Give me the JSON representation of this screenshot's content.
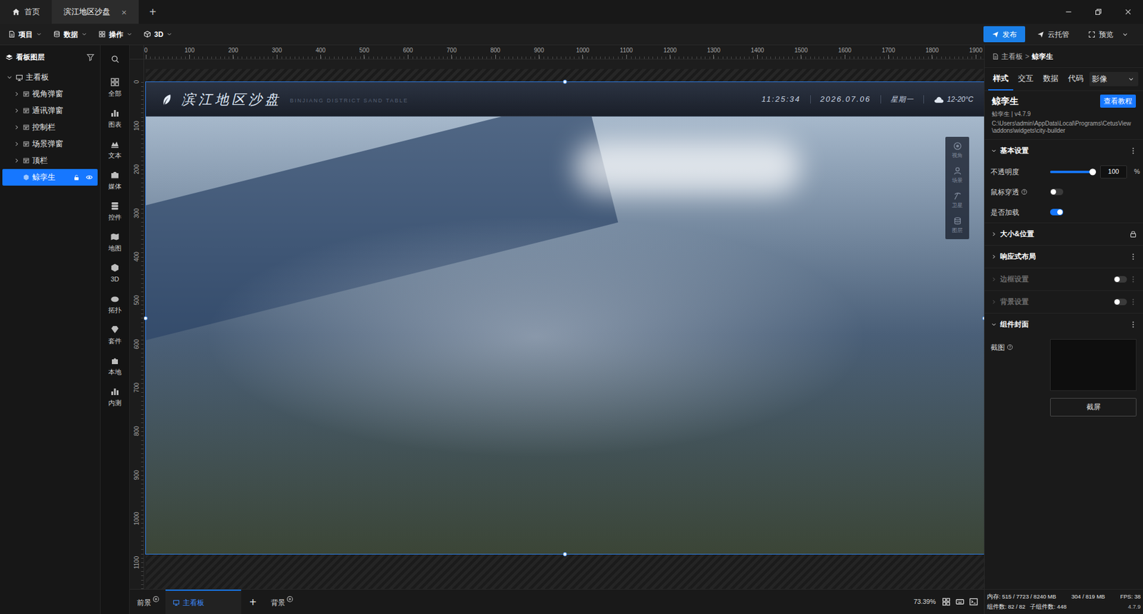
{
  "window": {
    "tabs": [
      {
        "label": "首页",
        "selected": false,
        "closable": false
      },
      {
        "label": "滨江地区沙盘",
        "selected": true,
        "closable": true
      }
    ],
    "close_glyph": "×",
    "new_tab": "+"
  },
  "menu": [
    "项目",
    "数据",
    "操作",
    "3D"
  ],
  "actions": [
    {
      "label": "发布",
      "kind": "primary"
    },
    {
      "label": "云托管",
      "kind": "plain"
    },
    {
      "label": "预览",
      "kind": "dropdown"
    }
  ],
  "layers": {
    "title": "看板图层",
    "items": [
      {
        "label": "主看板",
        "depth": 0,
        "kind": "board",
        "expanded": true,
        "selected": false
      },
      {
        "label": "视角弹窗",
        "depth": 1,
        "kind": "group",
        "expanded": false,
        "selected": false
      },
      {
        "label": "通讯弹窗",
        "depth": 1,
        "kind": "group",
        "expanded": false,
        "selected": false
      },
      {
        "label": "控制栏",
        "depth": 1,
        "kind": "group",
        "expanded": false,
        "selected": false
      },
      {
        "label": "场景弹窗",
        "depth": 1,
        "kind": "group",
        "expanded": false,
        "selected": false
      },
      {
        "label": "顶栏",
        "depth": 1,
        "kind": "group",
        "expanded": false,
        "selected": false
      },
      {
        "label": "鲸孪生",
        "depth": 1,
        "kind": "widget",
        "expanded": false,
        "selected": true,
        "locked": false,
        "visible": true
      }
    ]
  },
  "toolbox": [
    "全部",
    "图表",
    "文本",
    "媒体",
    "控件",
    "地图",
    "3D",
    "拓扑",
    "套件",
    "本地",
    "内测"
  ],
  "ruler": {
    "horizontal": [
      "0",
      "100",
      "200",
      "300",
      "400",
      "500",
      "600",
      "700",
      "800",
      "900",
      "1000",
      "1100",
      "1200",
      "1300",
      "1400",
      "1500",
      "1600",
      "1700",
      "1800",
      "1900"
    ],
    "vertical": [
      "0",
      "100",
      "200",
      "300",
      "400",
      "500",
      "600",
      "700",
      "800",
      "900",
      "1000",
      "1100"
    ]
  },
  "dashboard": {
    "title": "滨江地区沙盘",
    "subtitle": "BINJIANG DISTRICT SAND TABLE",
    "time": "11:25:34",
    "date": "2026.07.06",
    "weekday": "星期一",
    "weather": "12-20°C",
    "tools": [
      "视角",
      "场景",
      "卫星",
      "图层"
    ]
  },
  "bottom": {
    "items": [
      {
        "label": "前景",
        "kind": "layer",
        "selected": false
      },
      {
        "label": "主看板",
        "kind": "board",
        "selected": true
      },
      {
        "label": "+",
        "kind": "add",
        "selected": false
      },
      {
        "label": "背景",
        "kind": "layer",
        "selected": false
      }
    ],
    "zoom": "73.39%"
  },
  "inspector": {
    "breadcrumb": [
      "主看板",
      "鲸孪生"
    ],
    "separator": ">",
    "tabs": [
      {
        "label": "样式",
        "selected": true,
        "dropdown": false
      },
      {
        "label": "交互",
        "selected": false,
        "dropdown": false
      },
      {
        "label": "数据",
        "selected": false,
        "dropdown": false
      },
      {
        "label": "代码",
        "selected": false,
        "dropdown": false
      },
      {
        "label": "影像",
        "selected": false,
        "dropdown": true
      }
    ],
    "name": "鲸孪生",
    "tutorial": "查看教程",
    "version": "鲸孪生 | v4.7.9",
    "path": "C:\\Users\\admin\\AppData\\Local\\Programs\\CetusView\\addons\\widgets\\city-builder",
    "sections": [
      {
        "title": "基本设置",
        "kind": "menu",
        "expanded": true,
        "disabled": false,
        "fields": [
          {
            "label": "不透明度",
            "kind": "slider",
            "help": false,
            "level": 1,
            "value": "100",
            "unit": "%"
          },
          {
            "label": "鼠标穿透",
            "kind": "toggle",
            "help": true,
            "on": false
          },
          {
            "label": "是否加载",
            "kind": "toggle",
            "help": false,
            "on": true
          }
        ]
      },
      {
        "title": "大小&位置",
        "kind": "lock",
        "expanded": false,
        "disabled": false
      },
      {
        "title": "响应式布局",
        "kind": "menu",
        "expanded": false,
        "disabled": false
      },
      {
        "title": "边框设置",
        "kind": "toggle",
        "expanded": false,
        "disabled": true,
        "on": false
      },
      {
        "title": "背景设置",
        "kind": "toggle",
        "expanded": false,
        "disabled": true,
        "on": false
      },
      {
        "title": "组件封面",
        "kind": "menu",
        "expanded": true,
        "disabled": false,
        "fields": [
          {
            "label": "截图",
            "kind": "cover",
            "help": true,
            "button": "截屏"
          }
        ]
      }
    ]
  },
  "status": {
    "memory": "内存: 515 / 7723 / 8240 MB",
    "gpu": "304 / 819 MB",
    "fps": "FPS: 38",
    "widgets": "组件数: 82 / 82",
    "children": "子组件数: 448",
    "version": "4.7.9"
  }
}
